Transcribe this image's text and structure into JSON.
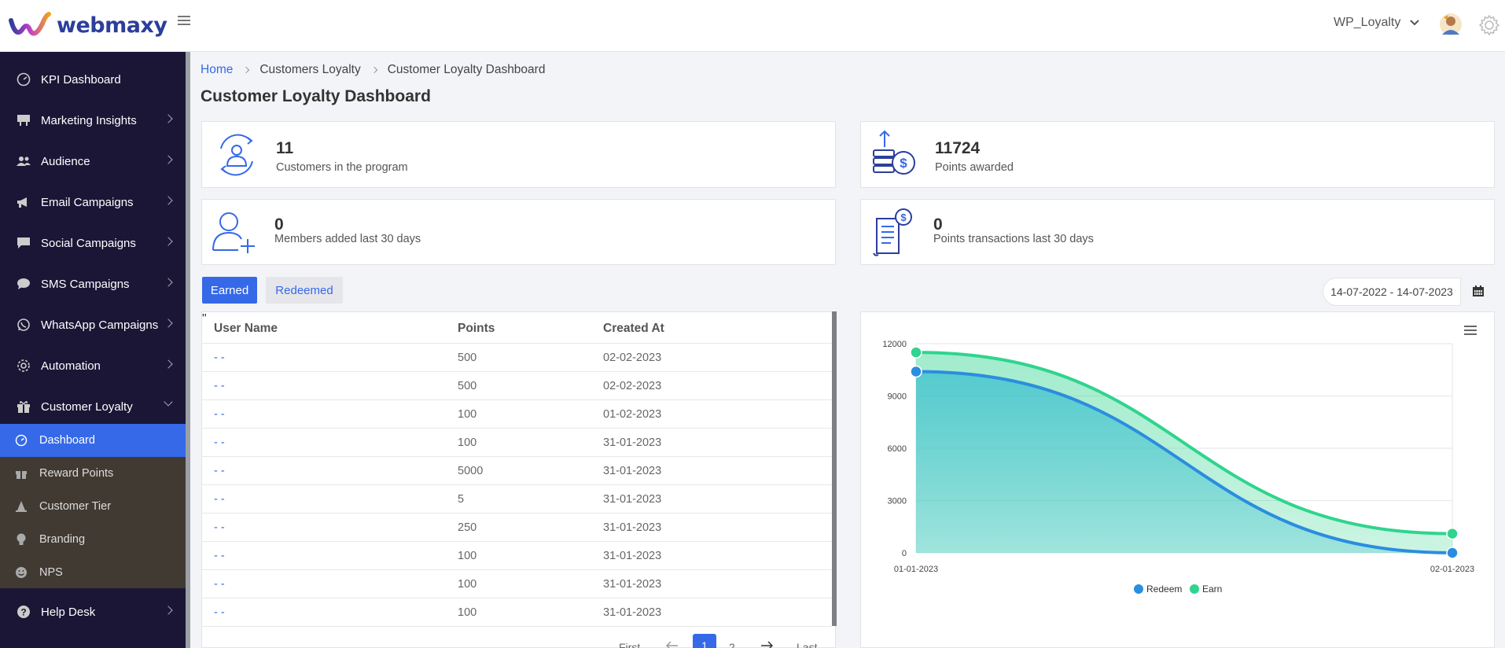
{
  "header": {
    "brand": "webmaxy",
    "account_name": "WP_Loyalty"
  },
  "sidebar": {
    "items": [
      {
        "label": "KPI Dashboard",
        "icon": "speedometer-icon"
      },
      {
        "label": "Marketing Insights",
        "icon": "billboard-icon"
      },
      {
        "label": "Audience",
        "icon": "users-icon"
      },
      {
        "label": "Email Campaigns",
        "icon": "megaphone-icon"
      },
      {
        "label": "Social Campaigns",
        "icon": "comment-icon"
      },
      {
        "label": "SMS Campaigns",
        "icon": "sms-icon"
      },
      {
        "label": "WhatsApp Campaigns",
        "icon": "whatsapp-icon"
      },
      {
        "label": "Automation",
        "icon": "cog-icon"
      },
      {
        "label": "Customer Loyalty",
        "icon": "gift-icon"
      }
    ],
    "subitems": [
      {
        "label": "Dashboard",
        "icon": "speedometer-icon"
      },
      {
        "label": "Reward Points",
        "icon": "gift-icon"
      },
      {
        "label": "Customer Tier",
        "icon": "cone-icon"
      },
      {
        "label": "Branding",
        "icon": "lightbulb-icon"
      },
      {
        "label": "NPS",
        "icon": "smile-icon"
      }
    ],
    "help": {
      "label": "Help Desk",
      "icon": "question-icon"
    }
  },
  "breadcrumb": {
    "home": "Home",
    "section": "Customers Loyalty",
    "current": "Customer Loyalty Dashboard"
  },
  "page_title": "Customer Loyalty Dashboard",
  "stats": {
    "customers": {
      "value": "11",
      "label": "Customers in the program"
    },
    "points_awarded": {
      "value": "11724",
      "label": "Points awarded"
    },
    "members_added": {
      "value": "0",
      "label": "Members added last 30 days"
    },
    "points_transactions": {
      "value": "0",
      "label": "Points transactions last 30 days"
    }
  },
  "tabs": {
    "earned": "Earned",
    "redeemed": "Redeemed"
  },
  "table": {
    "headers": [
      "User Name",
      "Points",
      "Created At"
    ],
    "rows": [
      {
        "user": "- -",
        "points": "500",
        "created": "02-02-2023"
      },
      {
        "user": "- -",
        "points": "500",
        "created": "02-02-2023"
      },
      {
        "user": "- -",
        "points": "100",
        "created": "01-02-2023"
      },
      {
        "user": "- -",
        "points": "100",
        "created": "31-01-2023"
      },
      {
        "user": "- -",
        "points": "5000",
        "created": "31-01-2023"
      },
      {
        "user": "- -",
        "points": "5",
        "created": "31-01-2023"
      },
      {
        "user": "- -",
        "points": "250",
        "created": "31-01-2023"
      },
      {
        "user": "- -",
        "points": "100",
        "created": "31-01-2023"
      },
      {
        "user": "- -",
        "points": "100",
        "created": "31-01-2023"
      },
      {
        "user": "- -",
        "points": "100",
        "created": "31-01-2023"
      }
    ],
    "pager": {
      "first": "First",
      "page1": "1",
      "page2": "2",
      "last": "Last"
    }
  },
  "date_range": "14-07-2022 - 14-07-2023",
  "colors": {
    "accent": "#3569e8",
    "sidebar": "#1b1636",
    "earn": "#2fd48e",
    "redeem": "#2b8de0"
  },
  "chart_data": {
    "type": "area",
    "x": [
      "01-01-2023",
      "02-01-2023"
    ],
    "series": [
      {
        "name": "Redeem",
        "values": [
          10400,
          0
        ]
      },
      {
        "name": "Earn",
        "values": [
          11500,
          1100
        ]
      }
    ],
    "yticks": [
      0,
      3000,
      6000,
      9000,
      12000
    ],
    "ylim": [
      0,
      12000
    ],
    "legend": "bottom-center",
    "grid": true
  }
}
